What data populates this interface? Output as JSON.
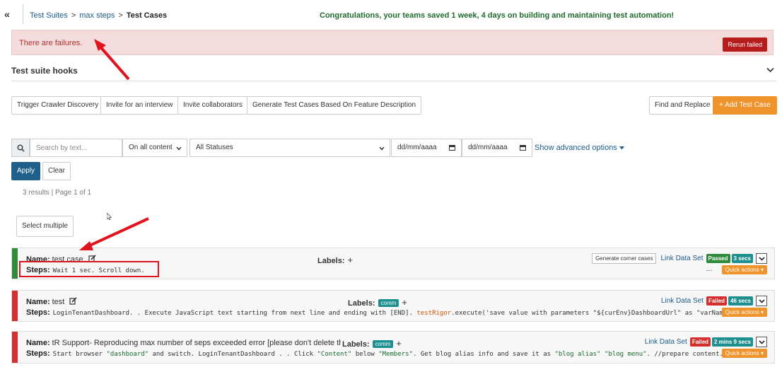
{
  "topbar": {
    "collapse_glyph": "«",
    "breadcrumb": [
      {
        "label": "Test Suites"
      },
      {
        "label": "max steps"
      },
      {
        "label": "Test Cases"
      }
    ],
    "breadcrumb_sep": ">",
    "congrats": "Congratulations, your teams saved 1 week, 4 days on building and maintaining test automation!"
  },
  "failure_bar": {
    "message": "There are failures.",
    "rerun_label": "Rerun failed"
  },
  "hooks": {
    "title": "Test suite hooks",
    "chevron_icon": "chevron-down-icon"
  },
  "actions": {
    "crawler": "Trigger Crawler Discovery",
    "interview": "Invite for an interview",
    "collaborators": "Invite collaborators",
    "generate": "Generate Test Cases Based On Feature Description",
    "find_replace": "Find and Replace",
    "add_test_case": "+  Add Test Case"
  },
  "filters": {
    "search_placeholder": "Search by text...",
    "content_scope": "On all content",
    "status": "All Statuses",
    "date_from": "dd/mm/aaaa",
    "date_to": "dd/mm/aaaa",
    "advanced": "Show advanced options",
    "apply": "Apply",
    "clear": "Clear",
    "results": "3 results | Page 1 of 1"
  },
  "select_multiple": "Select multiple",
  "common": {
    "name_label": "Name:",
    "steps_label": "Steps:",
    "labels_label": "Labels:",
    "link_data_set": "Link Data Set",
    "quick_actions": "Quick actions ▾",
    "ellipsis": "...",
    "generate_corner": "Generate corner cases"
  },
  "test_cases": [
    {
      "name": "test case",
      "steps": "Wait 1 sec. Scroll down.",
      "status": "Passed",
      "duration": "3 secs",
      "status_color": "#2e8b3a"
    },
    {
      "name": "test",
      "steps_pre": "LoginTenantDashboard. . Execute JavaScript text starting from next line and ending with [END]. ",
      "steps_hl": "testRigor",
      "steps_post": ".execute('save value with parameters \"${curEnv}DashboardUrl\" as \"varName\"');. ...",
      "tag": "comm",
      "status": "Failed",
      "duration": "46 secs",
      "status_color": "#d32f2f"
    },
    {
      "name": "tR Support- Reproducing max number of seps exceeded error [please don't delete this test,(",
      "steps_a": "Start browser ",
      "steps_s1": "\"dashboard\"",
      "steps_b": " and switch. LoginTenantDashboard . . Click ",
      "steps_s2": "\"Content\"",
      "steps_c": " below ",
      "steps_s3": "\"Members\"",
      "steps_d": ". Get blog alias info and save it as ",
      "steps_s4": "\"blog alias\" \"blog menu\"",
      "steps_e": ". //prepare content. Save \"...",
      "tag": "comm",
      "status": "Failed",
      "duration": "2 mins 9 secs",
      "status_color": "#d32f2f"
    }
  ],
  "colors": {
    "accent_blue": "#1f5f8b",
    "orange": "#f0932b",
    "fail_red": "#d32f2f",
    "pass_green": "#2e8b3a",
    "annotation_red": "#e0141e"
  }
}
